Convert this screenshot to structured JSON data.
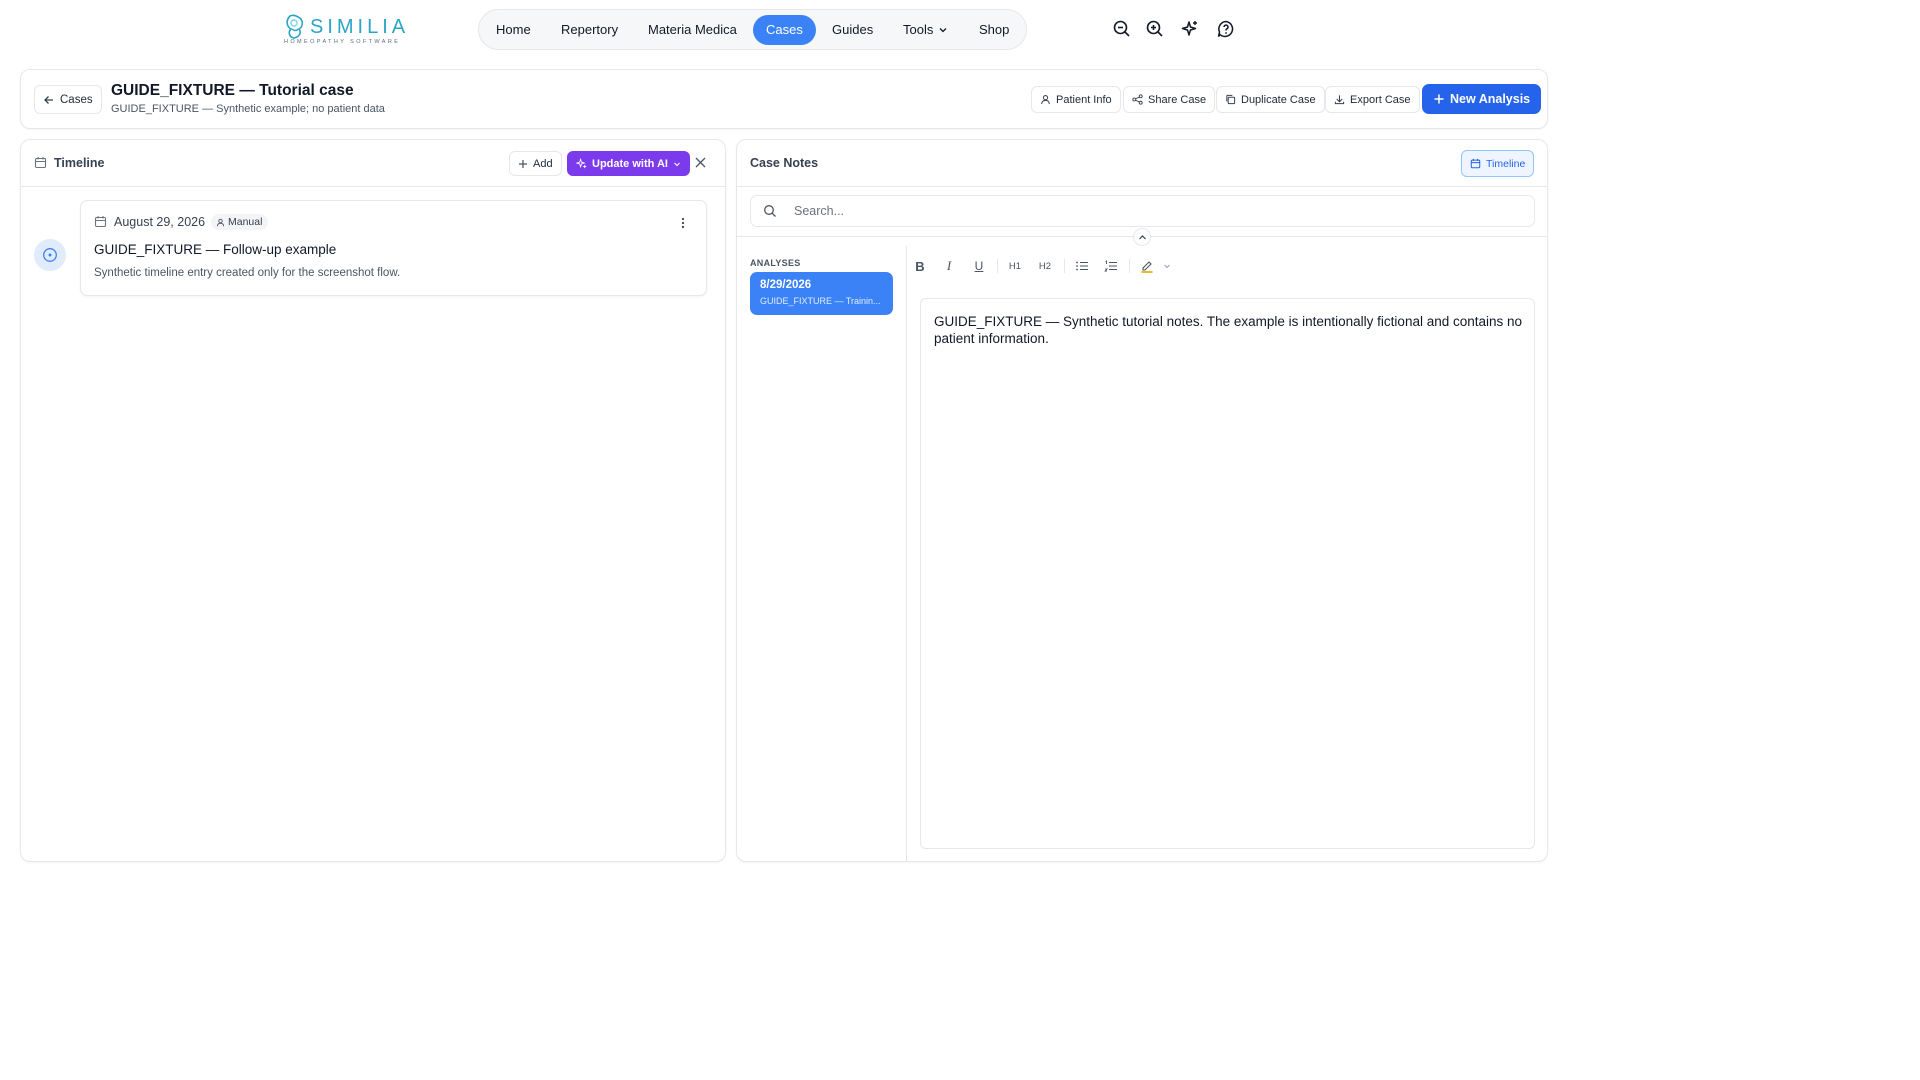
{
  "brand": {
    "name": "SIMILIA",
    "tagline": "HOMEOPATHY SOFTWARE"
  },
  "nav": {
    "items": [
      {
        "label": "Home"
      },
      {
        "label": "Repertory"
      },
      {
        "label": "Materia Medica"
      },
      {
        "label": "Cases",
        "active": true
      },
      {
        "label": "Guides"
      },
      {
        "label": "Tools"
      },
      {
        "label": "Shop"
      }
    ],
    "icons": [
      "zoom-out-icon",
      "zoom-in-icon",
      "sparkles-icon",
      "help-icon"
    ]
  },
  "case_header": {
    "back_label": "Cases",
    "title": "GUIDE_FIXTURE — Tutorial case",
    "subtitle": "GUIDE_FIXTURE — Synthetic example; no patient data",
    "actions": {
      "patient_info": "Patient Info",
      "share": "Share Case",
      "duplicate": "Duplicate Case",
      "export": "Export Case",
      "new_analysis": "New Analysis"
    }
  },
  "timeline": {
    "title": "Timeline",
    "add_label": "Add",
    "ai_label": "Update with AI",
    "entries": [
      {
        "date": "August 29, 2026",
        "source": "Manual",
        "title": "GUIDE_FIXTURE — Follow-up example",
        "description": "Synthetic timeline entry created only for the screenshot flow."
      }
    ]
  },
  "case_notes": {
    "title": "Case Notes",
    "timeline_toggle": "Timeline",
    "search_placeholder": "Search...",
    "analyses_heading": "ANALYSES",
    "analyses": [
      {
        "date": "8/29/2026",
        "name": "GUIDE_FIXTURE — Trainin..."
      }
    ],
    "toolbar": {
      "bold": "B",
      "italic": "I",
      "underline": "U",
      "h1": "H1",
      "h2": "H2"
    },
    "editor_text": "GUIDE_FIXTURE — Synthetic tutorial notes. The example is intentionally fictional and contains no patient information."
  },
  "colors": {
    "primary": "#2563eb",
    "active_nav": "#3b82f6",
    "ai_purple": "#7c3aed",
    "brand_teal": "#2aa5c4"
  }
}
